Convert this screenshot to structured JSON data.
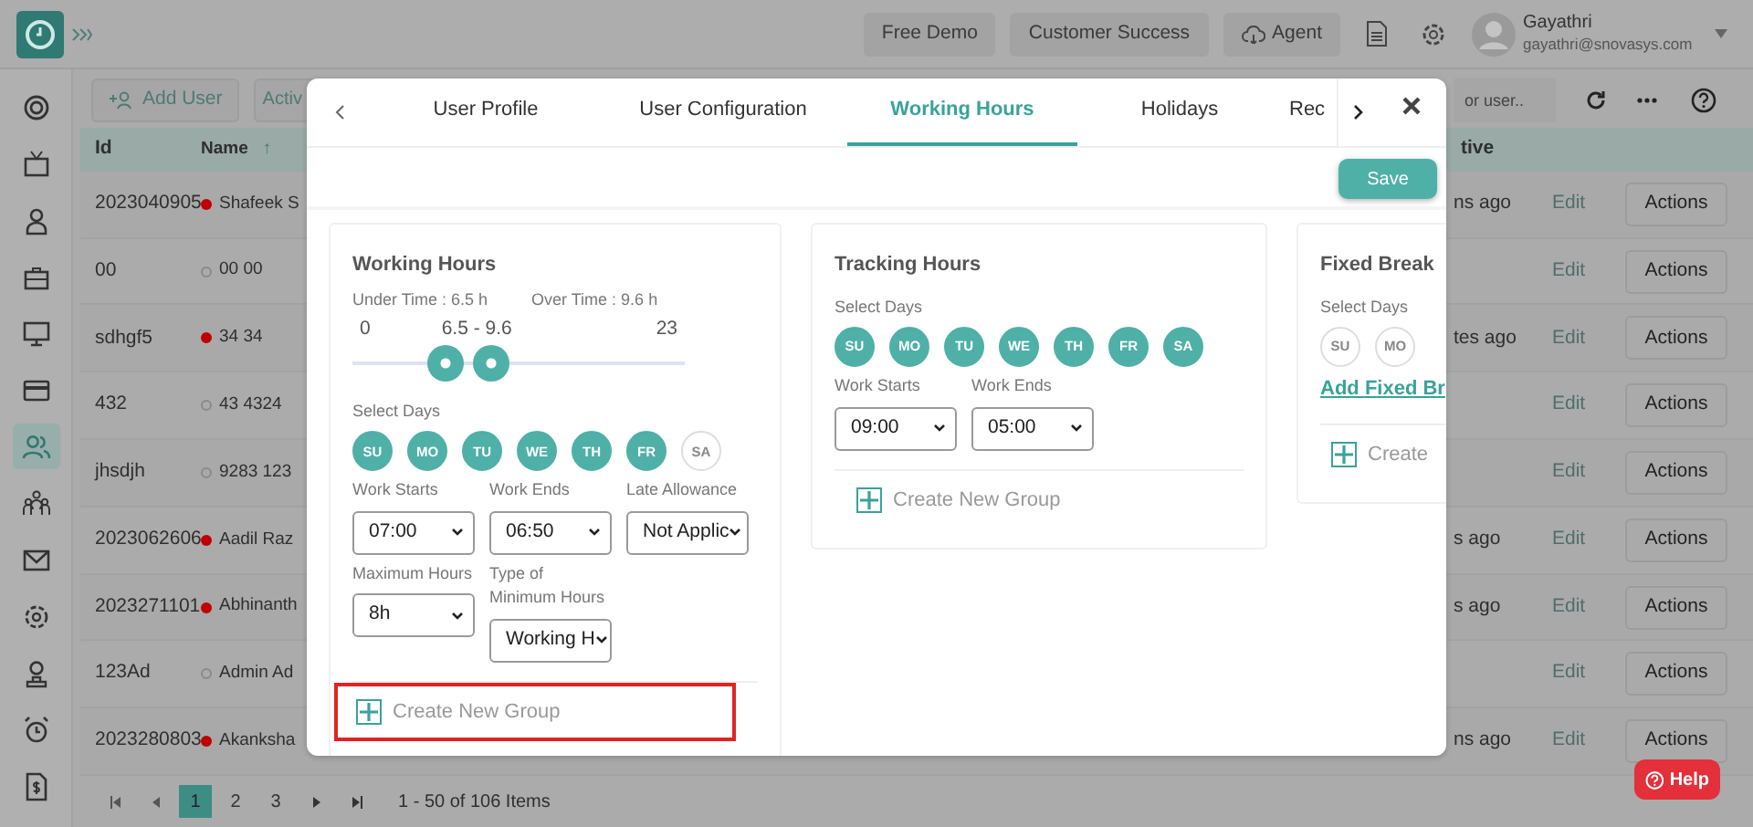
{
  "topbar": {
    "buttons": [
      {
        "label": "Free Demo",
        "kind": "text"
      },
      {
        "label": "Customer Success",
        "kind": "text"
      },
      {
        "label": "Agent",
        "kind": "cloud"
      }
    ],
    "user": {
      "name": "Gayathri",
      "email": "gayathri@snovasys.com"
    }
  },
  "sidebar": {
    "items": [
      {
        "kind": "target",
        "selected": false
      },
      {
        "kind": "tv",
        "selected": false
      },
      {
        "kind": "user",
        "selected": false
      },
      {
        "kind": "briefcase",
        "selected": false
      },
      {
        "kind": "monitor",
        "selected": false
      },
      {
        "kind": "card",
        "selected": false
      },
      {
        "kind": "users",
        "selected": true
      },
      {
        "kind": "team",
        "selected": false
      },
      {
        "kind": "mail",
        "selected": false
      },
      {
        "kind": "gear",
        "selected": false
      },
      {
        "kind": "badge",
        "selected": false
      },
      {
        "kind": "alarm",
        "selected": false
      },
      {
        "kind": "invoice",
        "selected": false
      }
    ]
  },
  "toolbar": {
    "add_button": "Add User",
    "filter_button": "Activ",
    "search": {
      "placeholder": "or user.."
    }
  },
  "table": {
    "columns": [
      {
        "label": "Id"
      },
      {
        "label": "Name",
        "sort": "↑"
      },
      {
        "label": "tive"
      }
    ],
    "rows": [
      {
        "id": "2023040905",
        "name": "Shafeek S",
        "active": true,
        "last_active": "ns ago",
        "edit": "Edit",
        "action": "Actions"
      },
      {
        "id": "00",
        "name": "00 00",
        "active": false,
        "edit": "Edit",
        "action": "Actions"
      },
      {
        "id": "sdhgf5",
        "name": "34 34",
        "active": true,
        "last_active": "tes ago",
        "edit": "Edit",
        "action": "Actions"
      },
      {
        "id": "432",
        "name": "43 4324",
        "active": false,
        "edit": "Edit",
        "action": "Actions"
      },
      {
        "id": "jhsdjh",
        "name": "9283 123",
        "active": false,
        "edit": "Edit",
        "action": "Actions"
      },
      {
        "id": "2023062606",
        "name": "Aadil Raz",
        "active": true,
        "last_active": "s ago",
        "edit": "Edit",
        "action": "Actions"
      },
      {
        "id": "2023271101",
        "name": "Abhinanth",
        "active": true,
        "last_active": "s ago",
        "edit": "Edit",
        "action": "Actions"
      },
      {
        "id": "123Ad",
        "name": "Admin Ad",
        "active": false,
        "edit": "Edit",
        "action": "Actions"
      },
      {
        "id": "2023280803",
        "name": "Akanksha",
        "active": true,
        "last_active": "ns ago",
        "edit": "Edit",
        "action": "Actions"
      }
    ]
  },
  "pagination": {
    "pages": [
      {
        "label": "1",
        "selected": true
      },
      {
        "label": "2",
        "selected": false
      },
      {
        "label": "3",
        "selected": false
      }
    ],
    "summary": "1 - 50 of 106 Items"
  },
  "modal": {
    "tabs": [
      {
        "label": "User Profile",
        "selected": false
      },
      {
        "label": "User Configuration",
        "selected": false
      },
      {
        "label": "Working Hours",
        "selected": true
      },
      {
        "label": "Holidays",
        "selected": false
      },
      {
        "label": "Rec",
        "selected": false
      }
    ],
    "save": "Save",
    "working_hours": {
      "title": "Working Hours",
      "under_time": "Under Time : 6.5 h",
      "over_time": "Over Time : 9.6 h",
      "range": {
        "min": "0",
        "reading": "6.5 - 9.6",
        "max": "23",
        "thumbs": [
          {
            "level": 0.28
          },
          {
            "level": 0.42
          }
        ]
      },
      "days_label": "Select Days",
      "days": [
        {
          "label": "SU",
          "selected": true
        },
        {
          "label": "MO",
          "selected": true
        },
        {
          "label": "TU",
          "selected": true
        },
        {
          "label": "WE",
          "selected": true
        },
        {
          "label": "TH",
          "selected": true
        },
        {
          "label": "FR",
          "selected": true
        },
        {
          "label": "SA",
          "selected": false
        }
      ],
      "fields": [
        {
          "label": "Work Starts",
          "value": "07:00"
        },
        {
          "label": "Work Ends",
          "value": "06:50"
        },
        {
          "label": "Late Allowance",
          "value": "Not Applic"
        }
      ],
      "fields_2": [
        {
          "label": "Maximum Hours",
          "value": "8h"
        },
        {
          "label": "Type of Minimum Hours",
          "value": "Working H"
        }
      ],
      "create_group": {
        "label": "Create New Group",
        "highlighted": true
      }
    },
    "tracking_hours": {
      "title": "Tracking Hours",
      "days_label": "Select Days",
      "days": [
        {
          "label": "SU",
          "selected": true
        },
        {
          "label": "MO",
          "selected": true
        },
        {
          "label": "TU",
          "selected": true
        },
        {
          "label": "WE",
          "selected": true
        },
        {
          "label": "TH",
          "selected": true
        },
        {
          "label": "FR",
          "selected": true
        },
        {
          "label": "SA",
          "selected": true
        }
      ],
      "fields": [
        {
          "label": "Work Starts",
          "value": "09:00"
        },
        {
          "label": "Work Ends",
          "value": "05:00"
        }
      ],
      "create_group": {
        "label": "Create New Group",
        "highlighted": false
      }
    },
    "fixed_breaks": {
      "title": "Fixed Break",
      "days_label": "Select Days",
      "days": [
        {
          "label": "SU",
          "selected": false
        },
        {
          "label": "MO",
          "selected": false
        }
      ],
      "add_link": "Add Fixed Br",
      "create_group": {
        "label": "Create",
        "highlighted": false
      }
    }
  },
  "help": "Help"
}
